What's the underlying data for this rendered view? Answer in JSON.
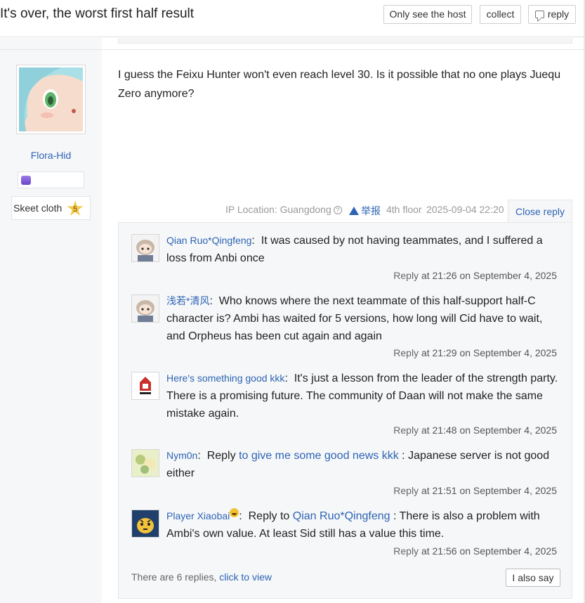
{
  "header": {
    "title": "It's over, the worst first half result",
    "buttons": {
      "host": "Only see the host",
      "collect": "collect",
      "reply": "reply"
    }
  },
  "author": {
    "name": "Flora-Hid",
    "level_name": "Skeet cloth",
    "level": "5"
  },
  "post": {
    "content": "I guess the Feixu Hunter won't even reach level 30. Is it possible that no one plays Juequ Zero anymore?",
    "ip_location": "IP Location: Guangdong",
    "help_icon": "?",
    "report": "举报",
    "floor": "4th floor",
    "time": "2025-09-04 22:20",
    "close_reply": "Close reply"
  },
  "replies": [
    {
      "user": "Qian Ruo*Qingfeng",
      "text": "It was caused by not having teammates, and I suffered a loss from Anbi once",
      "action": "Reply",
      "time": "at 21:26 on September 4, 2025"
    },
    {
      "user": "浅若*清风",
      "text": "Who knows where the next teammate of this half-support half-C character is? Ambi has waited for 5 versions, how long will Cid have to wait, and Orpheus has been cut again and again",
      "action": "Reply",
      "time": "at 21:29 on September 4, 2025"
    },
    {
      "user": "Here's something good kkk",
      "text": "It's just a lesson from the leader of the strength party. There is a promising future. The community of Daan will not make the same mistake again.",
      "action": "Reply",
      "time": "at 21:48 on September 4, 2025"
    },
    {
      "user": "Nym0n",
      "prefix": "Reply",
      "target": "to give me some good news kkk",
      "text": "Japanese server is not good either",
      "action": "Reply",
      "time": "at 21:51 on September 4, 2025"
    },
    {
      "user": "Player Xiaobai",
      "prefix": "Reply to",
      "target": "Qian Ruo*Qingfeng",
      "text": "There is also a problem with Ambi's own value. At least Sid still has a value this time.",
      "action": "Reply",
      "time": "at 21:56 on September 4, 2025"
    }
  ],
  "more": {
    "count_text": "There are 6 replies,",
    "link": "click to view",
    "also_say": "I also say"
  },
  "colors": {
    "link": "#2d64b3",
    "panel_bg": "#f6f7f9"
  },
  "icons": [
    "reply-icon",
    "help-icon",
    "warning-icon",
    "level-star-icon",
    "badge-gem-icon",
    "grin-emoji-icon"
  ]
}
